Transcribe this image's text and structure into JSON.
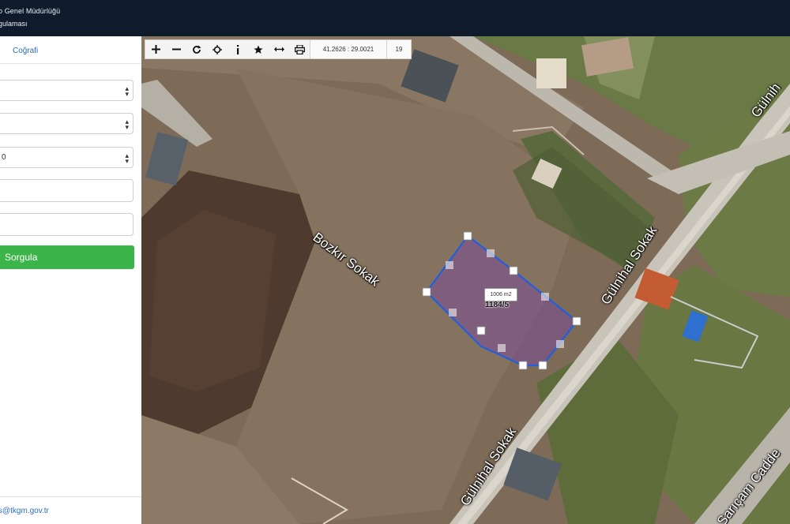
{
  "header": {
    "line1": "o Genel Müdürlüğü",
    "line2": "gulaması"
  },
  "sidebar": {
    "tab_label": "Coğrafi",
    "selects": [
      "",
      "",
      "0"
    ],
    "query_button": "Sorgula",
    "footer_email": "s@tkgm.gov.tr"
  },
  "toolbar": {
    "buttons": [
      "zoom-in",
      "zoom-out",
      "refresh",
      "locate",
      "info",
      "favorite",
      "measure",
      "print"
    ],
    "coordinates": "41.2626 : 29.0021",
    "zoom_level": "19"
  },
  "map": {
    "streets": [
      "Bozkır Sokak",
      "Gülnihal Sokak",
      "Gülnihal Sokak",
      "Gülnih",
      "Sarıçam Cadde"
    ],
    "parcel_area": "1006 m2",
    "parcel_number": "1184/5",
    "parcel_fill": "#7a4f8f",
    "parcel_outline": "#1f5fe0"
  }
}
